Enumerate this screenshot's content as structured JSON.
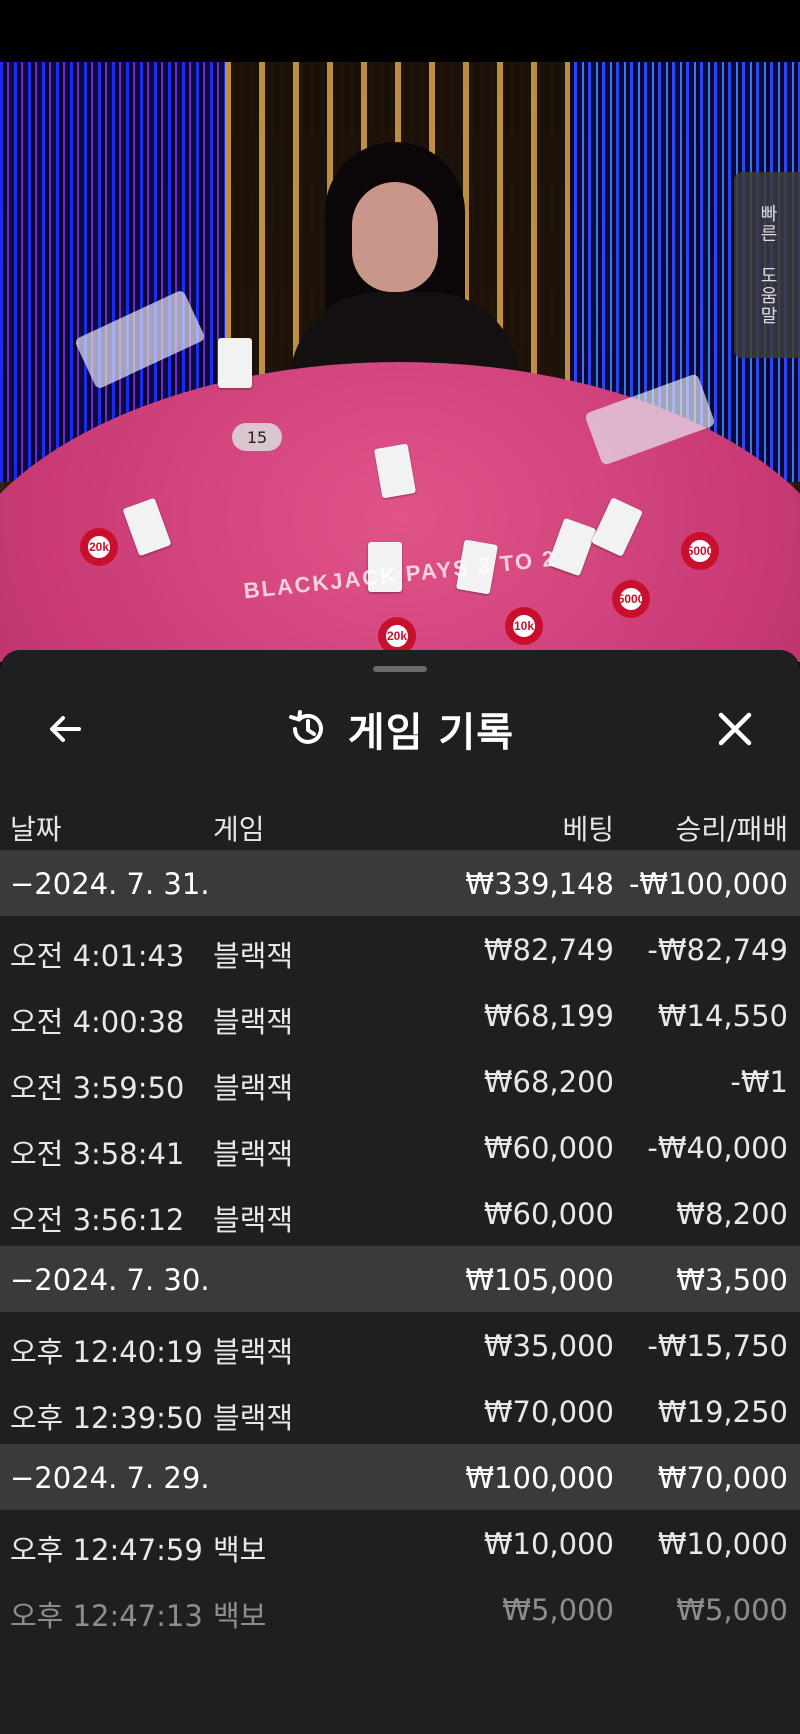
{
  "video": {
    "shoe_count": "15",
    "side_help": [
      "빠른",
      "도움말"
    ],
    "table_text": "BLACKJACK PAYS 3 TO 2",
    "chips": [
      "20k",
      "5000",
      "5000",
      "20k",
      "10k"
    ]
  },
  "sheet": {
    "title": "게임 기록",
    "icons": {
      "back": "arrow-left-icon",
      "history": "history-icon",
      "close": "close-icon"
    },
    "columns": {
      "date": "날짜",
      "game": "게임",
      "bet": "베팅",
      "result": "승리/패배"
    },
    "rows": [
      {
        "type": "group",
        "date": "−2024. 7. 31.",
        "game": "",
        "bet": "₩339,148",
        "result": "-₩100,000"
      },
      {
        "type": "item",
        "date": "오전 4:01:43",
        "game": "블랙잭",
        "bet": "₩82,749",
        "result": "-₩82,749"
      },
      {
        "type": "item",
        "date": "오전 4:00:38",
        "game": "블랙잭",
        "bet": "₩68,199",
        "result": "₩14,550"
      },
      {
        "type": "item",
        "date": "오전 3:59:50",
        "game": "블랙잭",
        "bet": "₩68,200",
        "result": "-₩1"
      },
      {
        "type": "item",
        "date": "오전 3:58:41",
        "game": "블랙잭",
        "bet": "₩60,000",
        "result": "-₩40,000"
      },
      {
        "type": "item",
        "date": "오전 3:56:12",
        "game": "블랙잭",
        "bet": "₩60,000",
        "result": "₩8,200"
      },
      {
        "type": "group",
        "date": "−2024. 7. 30.",
        "game": "",
        "bet": "₩105,000",
        "result": "₩3,500"
      },
      {
        "type": "item",
        "date": "오후 12:40:19",
        "game": "블랙잭",
        "bet": "₩35,000",
        "result": "-₩15,750"
      },
      {
        "type": "item",
        "date": "오후 12:39:50",
        "game": "블랙잭",
        "bet": "₩70,000",
        "result": "₩19,250"
      },
      {
        "type": "group",
        "date": "−2024. 7. 29.",
        "game": "",
        "bet": "₩100,000",
        "result": "₩70,000"
      },
      {
        "type": "item",
        "date": "오후 12:47:59",
        "game": "백보",
        "bet": "₩10,000",
        "result": "₩10,000"
      },
      {
        "type": "item",
        "date": "오후 12:47:13",
        "game": "백보",
        "bet": "₩5,000",
        "result": "₩5,000"
      }
    ]
  }
}
